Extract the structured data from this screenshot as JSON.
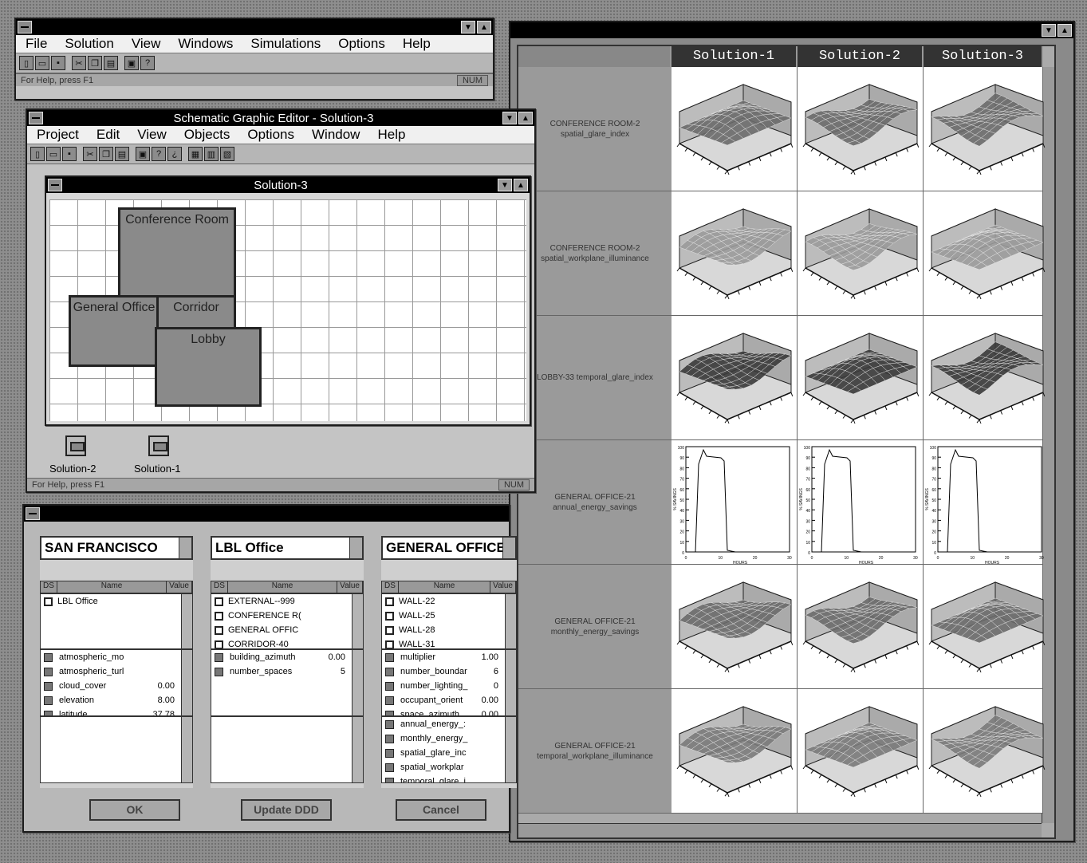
{
  "main_window": {
    "menu": [
      "File",
      "Solution",
      "View",
      "Windows",
      "Simulations",
      "Options",
      "Help"
    ],
    "status": "For Help, press F1",
    "num_indicator": "NUM"
  },
  "graph_window": {
    "columns": [
      "Solution-1",
      "Solution-2",
      "Solution-3"
    ],
    "rows": [
      {
        "label": "CONFERENCE ROOM-2 spatial_glare_index",
        "kind": "surface"
      },
      {
        "label": "CONFERENCE ROOM-2 spatial_workplane_illuminance",
        "kind": "surface"
      },
      {
        "label": "LOBBY-33 temporal_glare_index",
        "kind": "surface"
      },
      {
        "label": "GENERAL OFFICE-21 annual_energy_savings",
        "kind": "line"
      },
      {
        "label": "GENERAL OFFICE-21 monthly_energy_savings",
        "kind": "surface"
      },
      {
        "label": "GENERAL OFFICE-21 temporal_workplane_illuminance",
        "kind": "surface"
      }
    ],
    "line_plot": {
      "ylabel": "% SAVINGS",
      "xlabel": "HOURS",
      "xticks": [
        "0",
        "10",
        "20",
        "30"
      ],
      "yticks": [
        "100",
        "90",
        "80",
        "70",
        "60",
        "50",
        "40",
        "30",
        "20",
        "10",
        "0"
      ]
    }
  },
  "editor": {
    "title": "Schematic Graphic Editor - Solution-3",
    "menu": [
      "Project",
      "Edit",
      "View",
      "Objects",
      "Options",
      "Window",
      "Help"
    ],
    "doc_title": "Solution-3",
    "rooms": [
      {
        "label": "Conference Room"
      },
      {
        "label": "General Office"
      },
      {
        "label": "Corridor"
      },
      {
        "label": "Lobby"
      }
    ],
    "icons": [
      "Solution-2",
      "Solution-1"
    ],
    "status": "For Help, press F1",
    "num_indicator": "NUM"
  },
  "browser": {
    "panels": [
      {
        "combo": "SAN FRANCISCO",
        "headers": [
          "DS",
          "Name",
          "Value"
        ],
        "objects": [
          {
            "name": "LBL Office",
            "value": ""
          }
        ],
        "attributes": [
          {
            "name": "atmospheric_mo",
            "value": ""
          },
          {
            "name": "atmospheric_turl",
            "value": ""
          },
          {
            "name": "cloud_cover",
            "value": "0.00"
          },
          {
            "name": "elevation",
            "value": "8.00"
          },
          {
            "name": "latitude",
            "value": "37.78"
          }
        ],
        "outputs": []
      },
      {
        "combo": "LBL Office",
        "headers": [
          "DS",
          "Name",
          "Value"
        ],
        "objects": [
          {
            "name": "EXTERNAL--999",
            "value": ""
          },
          {
            "name": "CONFERENCE R(",
            "value": ""
          },
          {
            "name": "GENERAL OFFIC",
            "value": ""
          },
          {
            "name": "CORRIDOR-40",
            "value": ""
          }
        ],
        "attributes": [
          {
            "name": "building_azimuth",
            "value": "0.00"
          },
          {
            "name": "number_spaces",
            "value": "5"
          }
        ],
        "outputs": []
      },
      {
        "combo": "GENERAL OFFICE",
        "headers": [
          "DS",
          "Name",
          "Value"
        ],
        "objects": [
          {
            "name": "WALL-22",
            "value": ""
          },
          {
            "name": "WALL-25",
            "value": ""
          },
          {
            "name": "WALL-28",
            "value": ""
          },
          {
            "name": "WALL-31",
            "value": ""
          }
        ],
        "attributes": [
          {
            "name": "multiplier",
            "value": "1.00"
          },
          {
            "name": "number_boundar",
            "value": "6"
          },
          {
            "name": "number_lighting_",
            "value": "0"
          },
          {
            "name": "occupant_orient",
            "value": "0.00"
          },
          {
            "name": "space_azimuth",
            "value": "0.00"
          }
        ],
        "outputs": [
          {
            "name": "annual_energy_:"
          },
          {
            "name": "monthly_energy_"
          },
          {
            "name": "spatial_glare_inc"
          },
          {
            "name": "spatial_workplar"
          },
          {
            "name": "temporal_glare_i"
          }
        ]
      }
    ],
    "buttons": {
      "ok": "OK",
      "update": "Update DDD",
      "cancel": "Cancel"
    }
  }
}
